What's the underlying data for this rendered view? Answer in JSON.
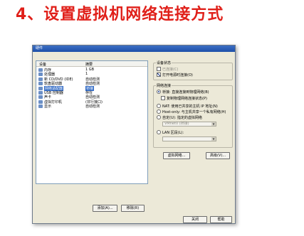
{
  "slide": {
    "title": "4、设置虚拟机网络连接方式"
  },
  "dialog": {
    "title": "硬件",
    "list": {
      "headers": {
        "device": "设备",
        "summary": "摘要"
      },
      "rows": [
        {
          "name": "内存",
          "summary": "1 GB",
          "icon": "memory-icon"
        },
        {
          "name": "处理器",
          "summary": "1",
          "icon": "cpu-icon"
        },
        {
          "name": "新 CD/DVD (IDE)",
          "summary": "自动检测",
          "icon": "cd-icon"
        },
        {
          "name": "软盘驱动器",
          "summary": "自动检测",
          "icon": "floppy-icon"
        },
        {
          "name": "网络适配器",
          "summary": "桥接",
          "icon": "network-icon",
          "selected": true
        },
        {
          "name": "USB 控制器",
          "summary": "存在",
          "icon": "usb-icon"
        },
        {
          "name": "声卡",
          "summary": "自动检测",
          "icon": "sound-icon"
        },
        {
          "name": "虚拟打印机",
          "summary": "(非行接口)",
          "icon": "printer-icon"
        },
        {
          "name": "显示",
          "summary": "自动检测",
          "icon": "display-icon"
        }
      ]
    },
    "add_button": "添加(A)...",
    "remove_button": "移除(R)",
    "device_status": {
      "label": "设备状态",
      "connected": "已连接(C)",
      "connect_at_power_on": "打开电源时连接(O)"
    },
    "network_connection": {
      "label": "网络连接",
      "bridged": "桥接: 直接连接到物理网络(B)",
      "replicate": "复制物理网络连接状态(P)",
      "nat": "NAT: 使用已共享的主机 IP 地址(N)",
      "host_only": "Host-only: 与主机共享一个私有网络(H)",
      "custom": "自定(U): 指定的虚拟网络",
      "custom_select": "VMnet0 (桥接)",
      "lan_segment": "LAN 区段(L):",
      "lan_select": ""
    },
    "advanced_button": "高级(V)...",
    "virtual_network_button": "虚拟网络...",
    "close_button": "关闭",
    "help_button": "帮助"
  }
}
